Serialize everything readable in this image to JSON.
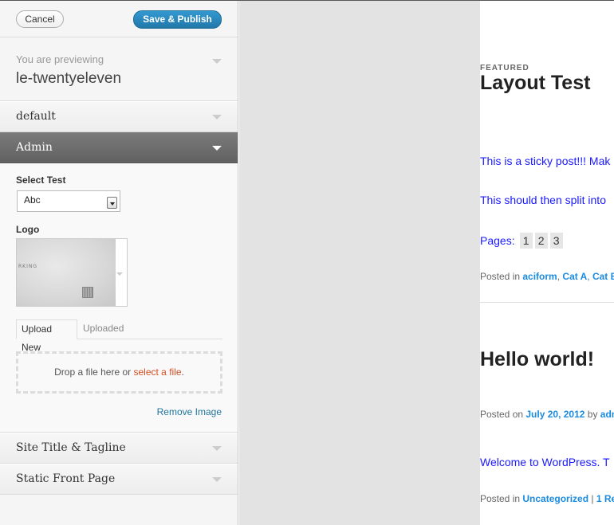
{
  "header": {
    "cancel_label": "Cancel",
    "publish_label": "Save & Publish"
  },
  "preview_box": {
    "label": "You are previewing",
    "theme": "le-twentyeleven"
  },
  "sections": {
    "default": "default",
    "admin": "Admin",
    "site_title": "Site Title & Tagline",
    "static_front": "Static Front Page"
  },
  "admin": {
    "select_label": "Select Test",
    "select_value": "Abc",
    "logo_label": "Logo",
    "logo_image_text": "RKING",
    "tab_upload_new": "Upload New",
    "tab_uploaded": "Uploaded",
    "drop_text": "Drop a file here or ",
    "drop_link": "select a file",
    "drop_suffix": ".",
    "remove_image": "Remove Image"
  },
  "preview": {
    "featured": "FEATURED",
    "post1_title": "Layout Test",
    "sticky_text": "This is a sticky post!!! Mak",
    "split_text": "This should then split into",
    "pages_label": "Pages:",
    "pages": [
      "1",
      "2",
      "3"
    ],
    "posted_in_prefix": "Posted in ",
    "cat1": "aciform",
    "cat2": "Cat A",
    "cat3": "Cat B",
    "comma": ", ",
    "post2_title": "Hello world!",
    "posted_on_prefix": "Posted on ",
    "post2_date": "July 20, 2012",
    "by": " by ",
    "author": "adm",
    "welcome_text": "Welcome to WordPress. T",
    "uncategorized": "Uncategorized",
    "pipe": " | ",
    "replies": "1 Re"
  }
}
